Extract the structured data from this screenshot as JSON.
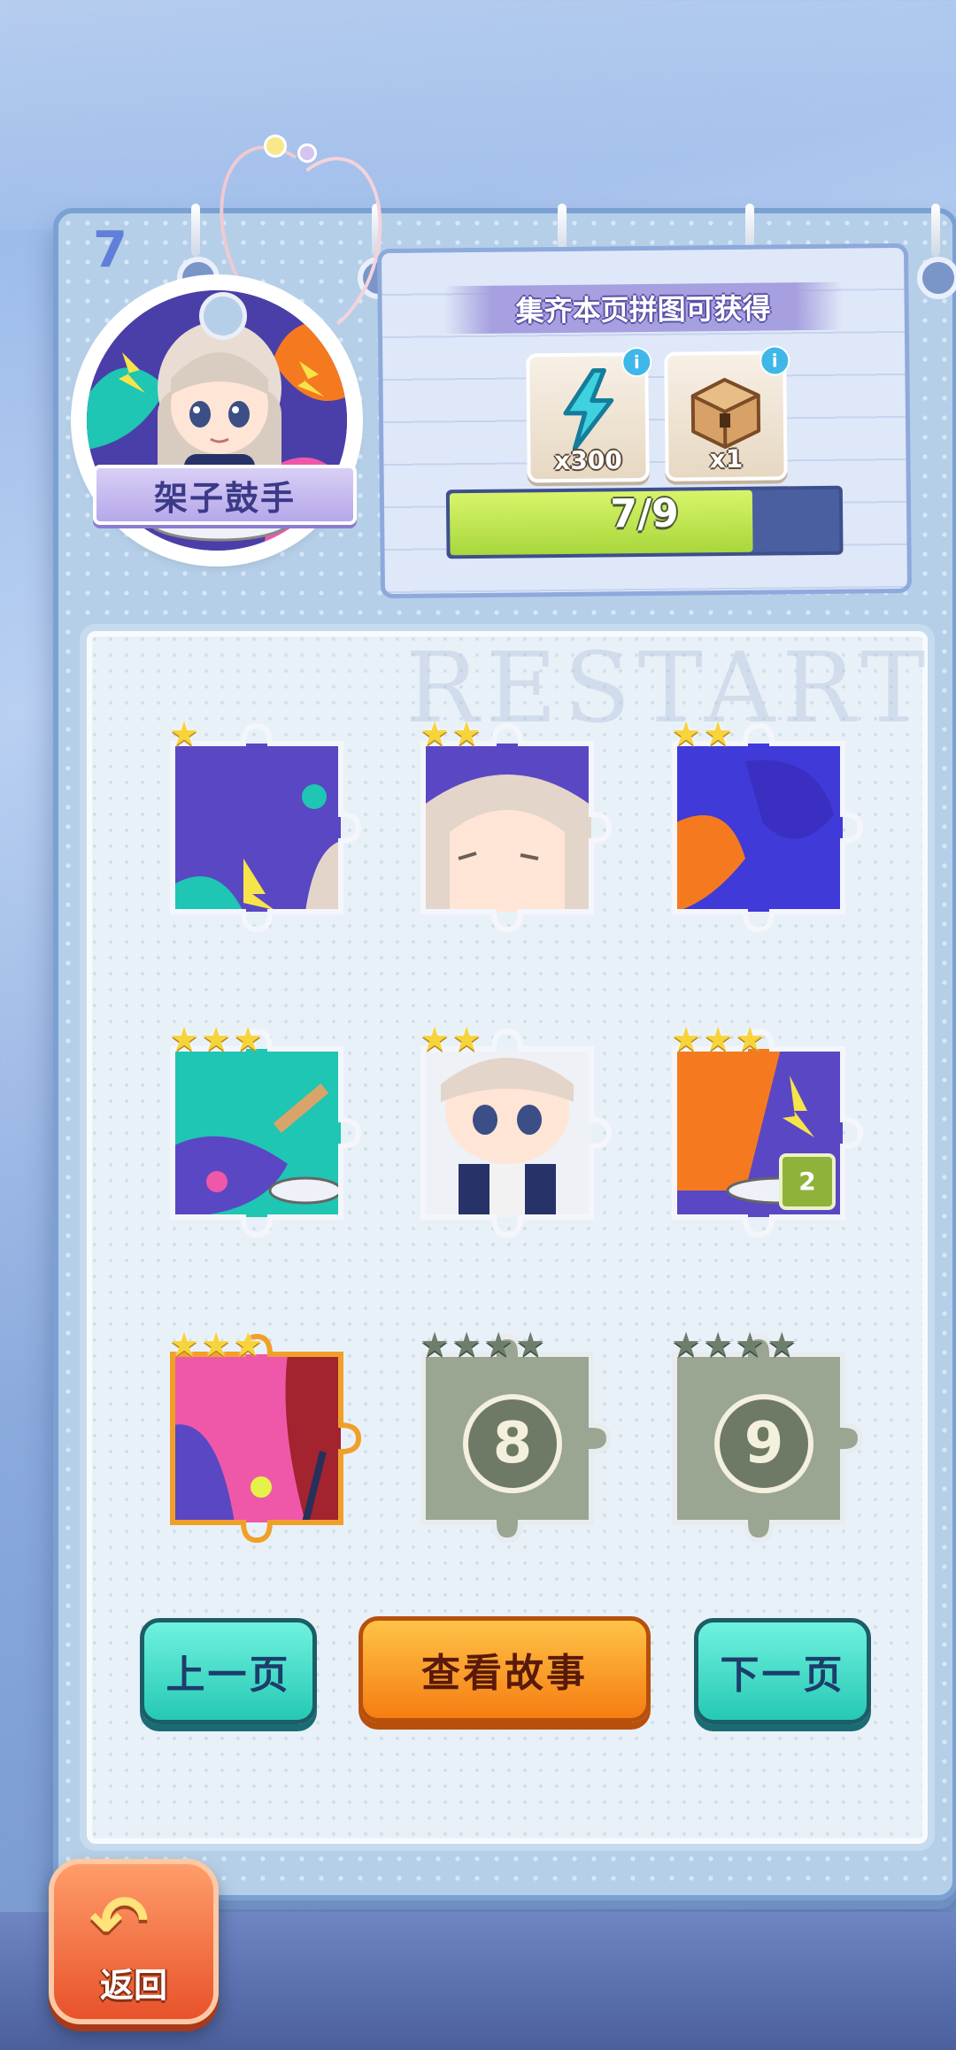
{
  "page": {
    "number": "7",
    "badge_title": "架子鼓手",
    "watermark": "RESTART"
  },
  "reward": {
    "title": "集齐本页拼图可获得",
    "items": [
      {
        "icon": "energy-bolt-icon",
        "qty": "x300",
        "info": "i"
      },
      {
        "icon": "treasure-chest-icon",
        "qty": "x1",
        "info": "i"
      }
    ],
    "progress": {
      "current": 7,
      "total": 9,
      "label": "7/9"
    }
  },
  "pieces": [
    {
      "stars": 1,
      "max_stars": 1,
      "state": "collected"
    },
    {
      "stars": 2,
      "max_stars": 2,
      "state": "collected"
    },
    {
      "stars": 2,
      "max_stars": 2,
      "state": "collected"
    },
    {
      "stars": 3,
      "max_stars": 3,
      "state": "collected"
    },
    {
      "stars": 2,
      "max_stars": 2,
      "state": "collected"
    },
    {
      "stars": 3,
      "max_stars": 3,
      "state": "collected",
      "count": "2"
    },
    {
      "stars": 3,
      "max_stars": 3,
      "state": "selected"
    },
    {
      "stars": 0,
      "max_stars": 4,
      "state": "locked",
      "number": "8"
    },
    {
      "stars": 0,
      "max_stars": 4,
      "state": "locked",
      "number": "9"
    }
  ],
  "buttons": {
    "prev": "上一页",
    "story": "查看故事",
    "next": "下一页",
    "back": "返回"
  },
  "colors": {
    "teal": "#25c9b4",
    "orange": "#f57d12",
    "progress_fill": "#a8d73c",
    "star": "#f7d43c",
    "locked": "#9aa592"
  }
}
